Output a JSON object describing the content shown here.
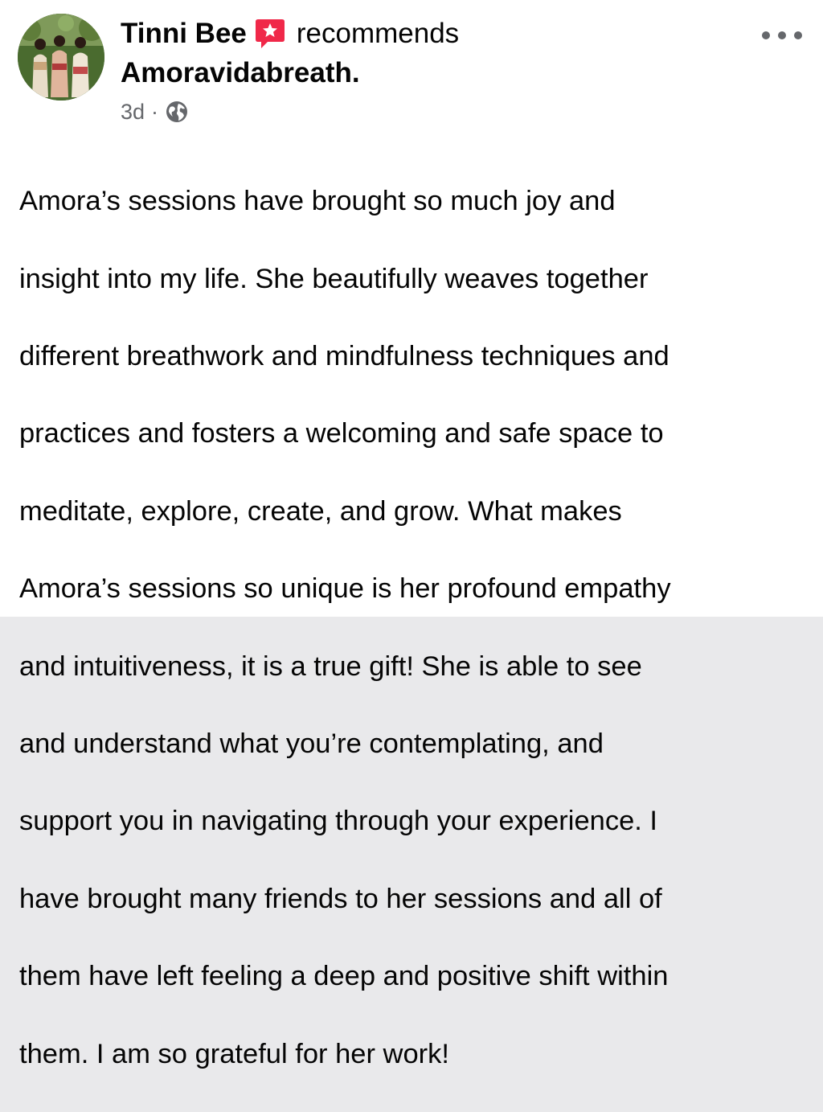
{
  "post": {
    "author": "Tinni Bee",
    "action": "recommends",
    "page_name": "Amoravidabreath.",
    "time": "3d",
    "separator": "·",
    "audience_icon": "globe-icon",
    "recommend_icon": "recommend-star-icon",
    "more_icon": "more-options-icon",
    "text_lines": [
      "Amora’s sessions have brought so much joy and",
      "insight into my life. She beautifully weaves together",
      "different breathwork and mindfulness techniques and",
      "practices and fosters a welcoming and safe space to",
      "meditate, explore, create, and grow. What makes",
      "Amora’s sessions so unique is her profound empathy",
      "and intuitiveness, it is a true gift! She is able to see",
      "and understand what you’re contemplating, and",
      "support you in navigating through your experience. I",
      "have brought many friends to her sessions and all of",
      "them have left feeling a deep and positive shift within",
      "them. I am so grateful for her work!"
    ]
  },
  "colors": {
    "text_primary": "#050505",
    "text_secondary": "#65676b",
    "recommend_badge": "#f02849",
    "background": "#ffffff"
  }
}
